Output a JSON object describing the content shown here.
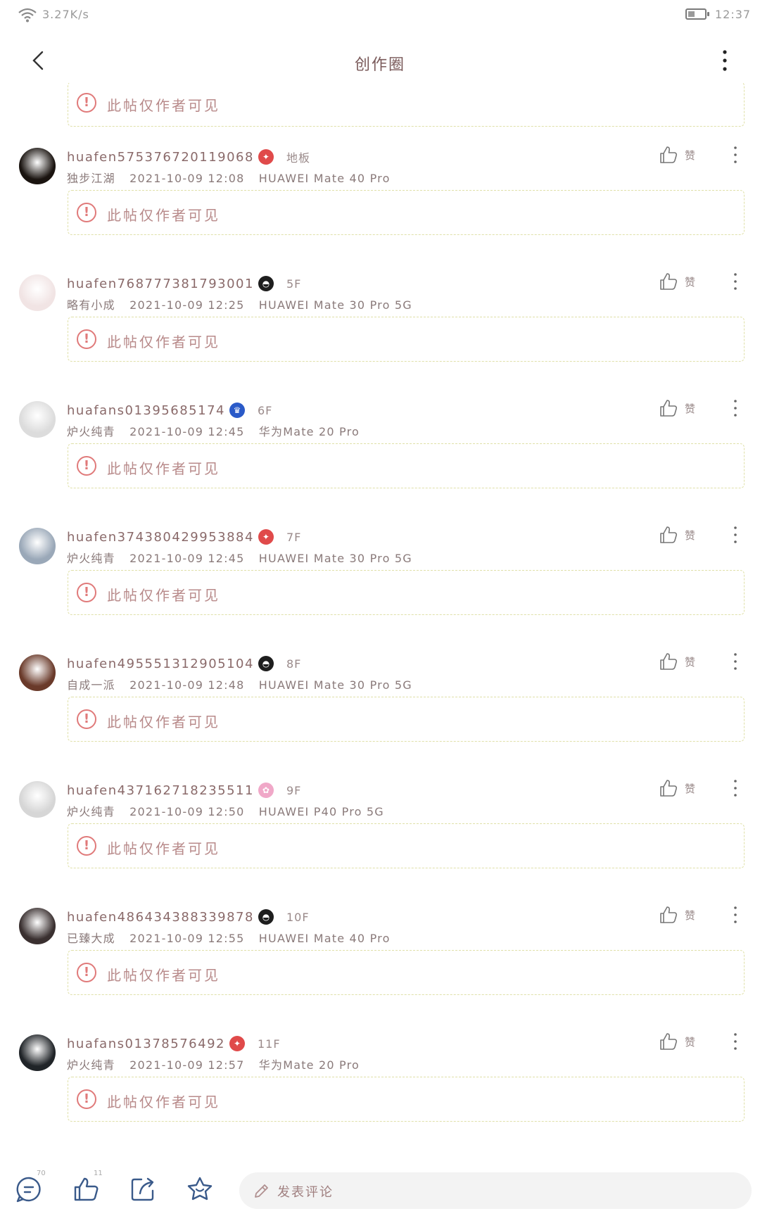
{
  "status_bar": {
    "net_speed": "3.27K/s",
    "time": "12:37",
    "battery_level_percent": 40
  },
  "nav": {
    "title": "创作圈",
    "back_icon": "chevron-left-icon",
    "more_icon": "more-vertical-icon"
  },
  "hidden_notice": "此帖仅作者可见",
  "like_label": "赞",
  "comments": [
    {
      "username": "huafen575376720119068",
      "badge": "red",
      "floor": "地板",
      "rank": "独步江湖",
      "time": "2021-10-09 12:08",
      "device": "HUAWEI Mate 40 Pro",
      "avatar_color": "#1a1410"
    },
    {
      "username": "huafen768777381793001",
      "badge": "dark",
      "floor": "5F",
      "rank": "略有小成",
      "time": "2021-10-09 12:25",
      "device": "HUAWEI Mate 30 Pro 5G",
      "avatar_color": "#f1e4e4"
    },
    {
      "username": "huafans01395685174",
      "badge": "blue",
      "floor": "6F",
      "rank": "炉火纯青",
      "time": "2021-10-09 12:45",
      "device": "华为Mate 20 Pro",
      "avatar_color": "#dcdcdc"
    },
    {
      "username": "huafen374380429953884",
      "badge": "red",
      "floor": "7F",
      "rank": "炉火纯青",
      "time": "2021-10-09 12:45",
      "device": "HUAWEI Mate 30 Pro 5G",
      "avatar_color": "#9aa8b8"
    },
    {
      "username": "huafen495551312905104",
      "badge": "dark",
      "floor": "8F",
      "rank": "自成一派",
      "time": "2021-10-09 12:48",
      "device": "HUAWEI Mate 30 Pro 5G",
      "avatar_color": "#6a3a2a"
    },
    {
      "username": "huafen437162718235511",
      "badge": "pink",
      "floor": "9F",
      "rank": "炉火纯青",
      "time": "2021-10-09 12:50",
      "device": "HUAWEI P40 Pro 5G",
      "avatar_color": "#d6d6d6"
    },
    {
      "username": "huafen486434388339878",
      "badge": "dark",
      "floor": "10F",
      "rank": "已臻大成",
      "time": "2021-10-09 12:55",
      "device": "HUAWEI Mate 40 Pro",
      "avatar_color": "#3a3030"
    },
    {
      "username": "huafans01378576492",
      "badge": "red",
      "floor": "11F",
      "rank": "炉火纯青",
      "time": "2021-10-09 12:57",
      "device": "华为Mate 20 Pro",
      "avatar_color": "#202428"
    }
  ],
  "bottom_bar": {
    "comment_count": "70",
    "like_count": "11",
    "input_placeholder": "发表评论",
    "icons": [
      "comment-icon",
      "like-icon",
      "share-icon",
      "favorite-icon",
      "pen-icon"
    ]
  },
  "colors": {
    "dash_border": "#dfe0a8",
    "warning": "#e07a7a",
    "text_primary": "#8a6a6a"
  }
}
